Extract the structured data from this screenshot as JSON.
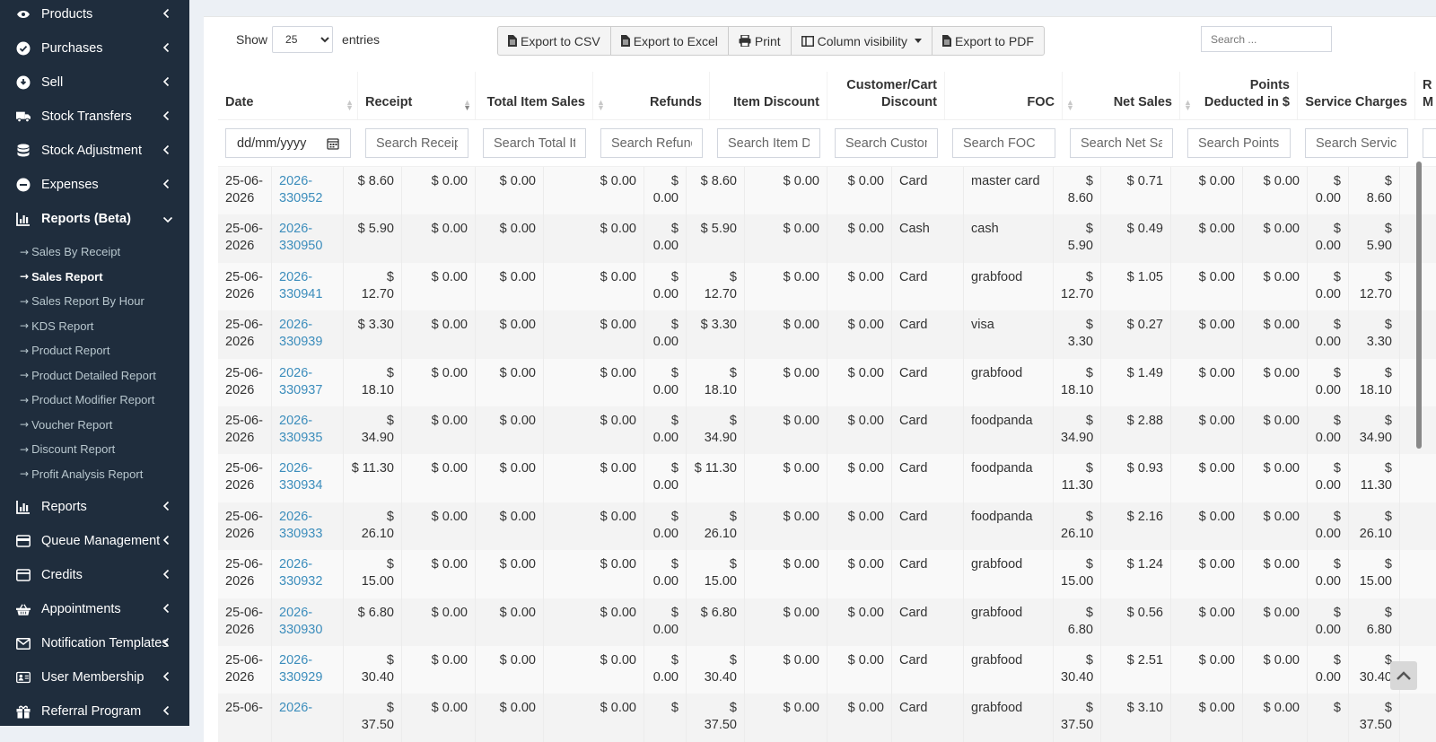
{
  "sidebar": {
    "items_top": [
      {
        "label": "Products",
        "icon": "products-icon"
      },
      {
        "label": "Purchases",
        "icon": "purchases-icon"
      },
      {
        "label": "Sell",
        "icon": "sell-icon"
      },
      {
        "label": "Stock Transfers",
        "icon": "truck-icon"
      },
      {
        "label": "Stock Adjustment",
        "icon": "database-icon"
      },
      {
        "label": "Expenses",
        "icon": "minus-circle-icon"
      },
      {
        "label": "Reports (Beta)",
        "icon": "bar-chart-icon"
      }
    ],
    "sub_items": [
      "Sales By Receipt",
      "Sales Report",
      "Sales Report By Hour",
      "KDS Report",
      "Product Report",
      "Product Detailed Report",
      "Product Modifier Report",
      "Voucher Report",
      "Discount Report",
      "Profit Analysis Report"
    ],
    "sub_arrow": "→",
    "items_bottom": [
      {
        "label": "Reports",
        "icon": "bar-chart-icon"
      },
      {
        "label": "Queue Management",
        "icon": "card-icon"
      },
      {
        "label": "Credits",
        "icon": "wallet-icon"
      },
      {
        "label": "Appointments",
        "icon": "basket-icon"
      },
      {
        "label": "Notification Templates",
        "icon": "envelope-icon"
      },
      {
        "label": "User Membership",
        "icon": "id-card-icon"
      },
      {
        "label": "Referral Program",
        "icon": "gift-icon"
      }
    ]
  },
  "controls": {
    "show_label": "Show",
    "entries_value": "25",
    "entries_label": "entries",
    "buttons": {
      "csv": "Export to CSV",
      "excel": "Export to Excel",
      "print": "Print",
      "columns": "Column visibility",
      "pdf": "Export to PDF"
    },
    "search_placeholder": "Search ..."
  },
  "table": {
    "headers": {
      "date": "Date",
      "receipt": "Receipt",
      "total_item_sales": "Total Item Sales",
      "refunds": "Refunds",
      "item_discount": "Item Discount",
      "cart_discount_1": "Customer/Cart",
      "cart_discount_2": "Discount",
      "foc": "FOC",
      "net_sales": "Net Sales",
      "points_1": "Points",
      "points_2": "Deducted in $",
      "service_charges": "Service Charges",
      "last_1": "R",
      "last_2": "M"
    },
    "filters": {
      "date": "dd/mm/yyyy",
      "receipt": "Search Receipt",
      "total_item_sales": "Search Total Item Sales",
      "refunds": "Search Refunds",
      "item_discount": "Search Item Discount",
      "cart_discount": "Search Customer/Cart Discount",
      "foc": "Search FOC",
      "net_sales": "Search Net Sales",
      "points": "Search Points Deducted",
      "service_charges": "Search Service Charges"
    },
    "rows": [
      {
        "date": "25-06-2026",
        "receipt": "2026-330952",
        "gross": "$ 8.60",
        "c3": "$ 0.00",
        "c4": "$ 0.00",
        "c5": "$ 0.00",
        "c6": "$ 0.00",
        "c7": "$ 8.60",
        "c8": "$ 0.00",
        "c9": "$ 0.00",
        "pay": "Card",
        "method": "master card",
        "net": "$ 8.60",
        "tax": "$ 0.71",
        "c13": "$ 0.00",
        "c14": "$ 0.00",
        "c15": "$ 0.00",
        "total": "$ 8.60"
      },
      {
        "date": "25-06-2026",
        "receipt": "2026-330950",
        "gross": "$ 5.90",
        "c3": "$ 0.00",
        "c4": "$ 0.00",
        "c5": "$ 0.00",
        "c6": "$ 0.00",
        "c7": "$ 5.90",
        "c8": "$ 0.00",
        "c9": "$ 0.00",
        "pay": "Cash",
        "method": "cash",
        "net": "$ 5.90",
        "tax": "$ 0.49",
        "c13": "$ 0.00",
        "c14": "$ 0.00",
        "c15": "$ 0.00",
        "total": "$ 5.90"
      },
      {
        "date": "25-06-2026",
        "receipt": "2026-330941",
        "gross": "$ 12.70",
        "c3": "$ 0.00",
        "c4": "$ 0.00",
        "c5": "$ 0.00",
        "c6": "$ 0.00",
        "c7": "$ 12.70",
        "c8": "$ 0.00",
        "c9": "$ 0.00",
        "pay": "Card",
        "method": "grabfood",
        "net": "$ 12.70",
        "tax": "$ 1.05",
        "c13": "$ 0.00",
        "c14": "$ 0.00",
        "c15": "$ 0.00",
        "total": "$ 12.70"
      },
      {
        "date": "25-06-2026",
        "receipt": "2026-330939",
        "gross": "$ 3.30",
        "c3": "$ 0.00",
        "c4": "$ 0.00",
        "c5": "$ 0.00",
        "c6": "$ 0.00",
        "c7": "$ 3.30",
        "c8": "$ 0.00",
        "c9": "$ 0.00",
        "pay": "Card",
        "method": "visa",
        "net": "$ 3.30",
        "tax": "$ 0.27",
        "c13": "$ 0.00",
        "c14": "$ 0.00",
        "c15": "$ 0.00",
        "total": "$ 3.30"
      },
      {
        "date": "25-06-2026",
        "receipt": "2026-330937",
        "gross": "$ 18.10",
        "c3": "$ 0.00",
        "c4": "$ 0.00",
        "c5": "$ 0.00",
        "c6": "$ 0.00",
        "c7": "$ 18.10",
        "c8": "$ 0.00",
        "c9": "$ 0.00",
        "pay": "Card",
        "method": "grabfood",
        "net": "$ 18.10",
        "tax": "$ 1.49",
        "c13": "$ 0.00",
        "c14": "$ 0.00",
        "c15": "$ 0.00",
        "total": "$ 18.10"
      },
      {
        "date": "25-06-2026",
        "receipt": "2026-330935",
        "gross": "$ 34.90",
        "c3": "$ 0.00",
        "c4": "$ 0.00",
        "c5": "$ 0.00",
        "c6": "$ 0.00",
        "c7": "$ 34.90",
        "c8": "$ 0.00",
        "c9": "$ 0.00",
        "pay": "Card",
        "method": "foodpanda",
        "net": "$ 34.90",
        "tax": "$ 2.88",
        "c13": "$ 0.00",
        "c14": "$ 0.00",
        "c15": "$ 0.00",
        "total": "$ 34.90"
      },
      {
        "date": "25-06-2026",
        "receipt": "2026-330934",
        "gross": "$ 11.30",
        "c3": "$ 0.00",
        "c4": "$ 0.00",
        "c5": "$ 0.00",
        "c6": "$ 0.00",
        "c7": "$ 11.30",
        "c8": "$ 0.00",
        "c9": "$ 0.00",
        "pay": "Card",
        "method": "foodpanda",
        "net": "$ 11.30",
        "tax": "$ 0.93",
        "c13": "$ 0.00",
        "c14": "$ 0.00",
        "c15": "$ 0.00",
        "total": "$ 11.30"
      },
      {
        "date": "25-06-2026",
        "receipt": "2026-330933",
        "gross": "$ 26.10",
        "c3": "$ 0.00",
        "c4": "$ 0.00",
        "c5": "$ 0.00",
        "c6": "$ 0.00",
        "c7": "$ 26.10",
        "c8": "$ 0.00",
        "c9": "$ 0.00",
        "pay": "Card",
        "method": "foodpanda",
        "net": "$ 26.10",
        "tax": "$ 2.16",
        "c13": "$ 0.00",
        "c14": "$ 0.00",
        "c15": "$ 0.00",
        "total": "$ 26.10"
      },
      {
        "date": "25-06-2026",
        "receipt": "2026-330932",
        "gross": "$ 15.00",
        "c3": "$ 0.00",
        "c4": "$ 0.00",
        "c5": "$ 0.00",
        "c6": "$ 0.00",
        "c7": "$ 15.00",
        "c8": "$ 0.00",
        "c9": "$ 0.00",
        "pay": "Card",
        "method": "grabfood",
        "net": "$ 15.00",
        "tax": "$ 1.24",
        "c13": "$ 0.00",
        "c14": "$ 0.00",
        "c15": "$ 0.00",
        "total": "$ 15.00"
      },
      {
        "date": "25-06-2026",
        "receipt": "2026-330930",
        "gross": "$ 6.80",
        "c3": "$ 0.00",
        "c4": "$ 0.00",
        "c5": "$ 0.00",
        "c6": "$ 0.00",
        "c7": "$ 6.80",
        "c8": "$ 0.00",
        "c9": "$ 0.00",
        "pay": "Card",
        "method": "grabfood",
        "net": "$ 6.80",
        "tax": "$ 0.56",
        "c13": "$ 0.00",
        "c14": "$ 0.00",
        "c15": "$ 0.00",
        "total": "$ 6.80"
      },
      {
        "date": "25-06-2026",
        "receipt": "2026-330929",
        "gross": "$ 30.40",
        "c3": "$ 0.00",
        "c4": "$ 0.00",
        "c5": "$ 0.00",
        "c6": "$ 0.00",
        "c7": "$ 30.40",
        "c8": "$ 0.00",
        "c9": "$ 0.00",
        "pay": "Card",
        "method": "grabfood",
        "net": "$ 30.40",
        "tax": "$ 2.51",
        "c13": "$ 0.00",
        "c14": "$ 0.00",
        "c15": "$ 0.00",
        "total": "$ 30.40"
      },
      {
        "date": "25-06-",
        "receipt": "2026-",
        "gross": "$ 37.50",
        "c3": "$ 0.00",
        "c4": "$ 0.00",
        "c5": "$ 0.00",
        "c6": "$",
        "c7": "$ 37.50",
        "c8": "$ 0.00",
        "c9": "$ 0.00",
        "pay": "Card",
        "method": "grabfood",
        "net": "$ 37.50",
        "tax": "$ 3.10",
        "c13": "$ 0.00",
        "c14": "$ 0.00",
        "c15": "$",
        "total": "$ 37.50"
      }
    ]
  },
  "colors": {
    "sidebar_bg": "#1f2d3d",
    "link": "#3c8dbc"
  }
}
